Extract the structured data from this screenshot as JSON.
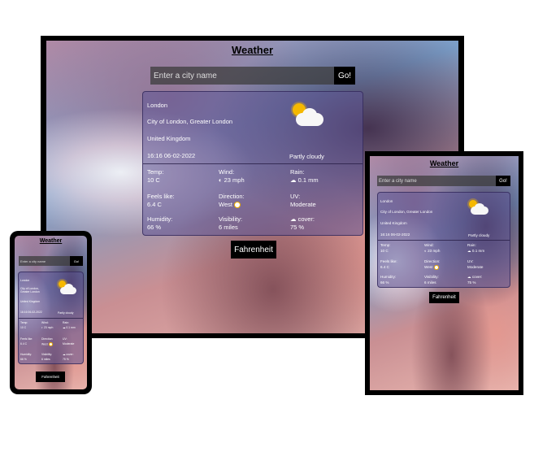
{
  "app": {
    "title": "Weather"
  },
  "search": {
    "placeholder": "Enter a city name",
    "go_label": "Go!"
  },
  "location": {
    "city": "London",
    "region": "City of London, Greater London",
    "country": "United Kingdom",
    "datetime": "16:16 06-02-2022",
    "condition": "Partly cloudy"
  },
  "stats": {
    "temp_label": "Temp:",
    "temp_value": "10 C",
    "wind_label": "Wind:",
    "wind_value": "23 mph",
    "rain_label": "Rain:",
    "rain_value": "0.1 mm",
    "feels_label": "Feels like:",
    "feels_value": "6.4 C",
    "direction_label": "Direction:",
    "direction_value": "West",
    "uv_label": "UV:",
    "uv_value": "Moderate",
    "humidity_label": "Humidity:",
    "humidity_value": "66 %",
    "visibility_label": "Visibility:",
    "visibility_value": "6 miles",
    "cover_label": "cover:",
    "cover_value": "75 %"
  },
  "unit_toggle": {
    "label": "Fahrenheit"
  },
  "icons": {
    "weather": "partly-cloudy-icon",
    "wind": "wind-icon",
    "rain": "rain-cloud-icon",
    "direction": "compass-icon",
    "cover": "cloud-icon"
  }
}
